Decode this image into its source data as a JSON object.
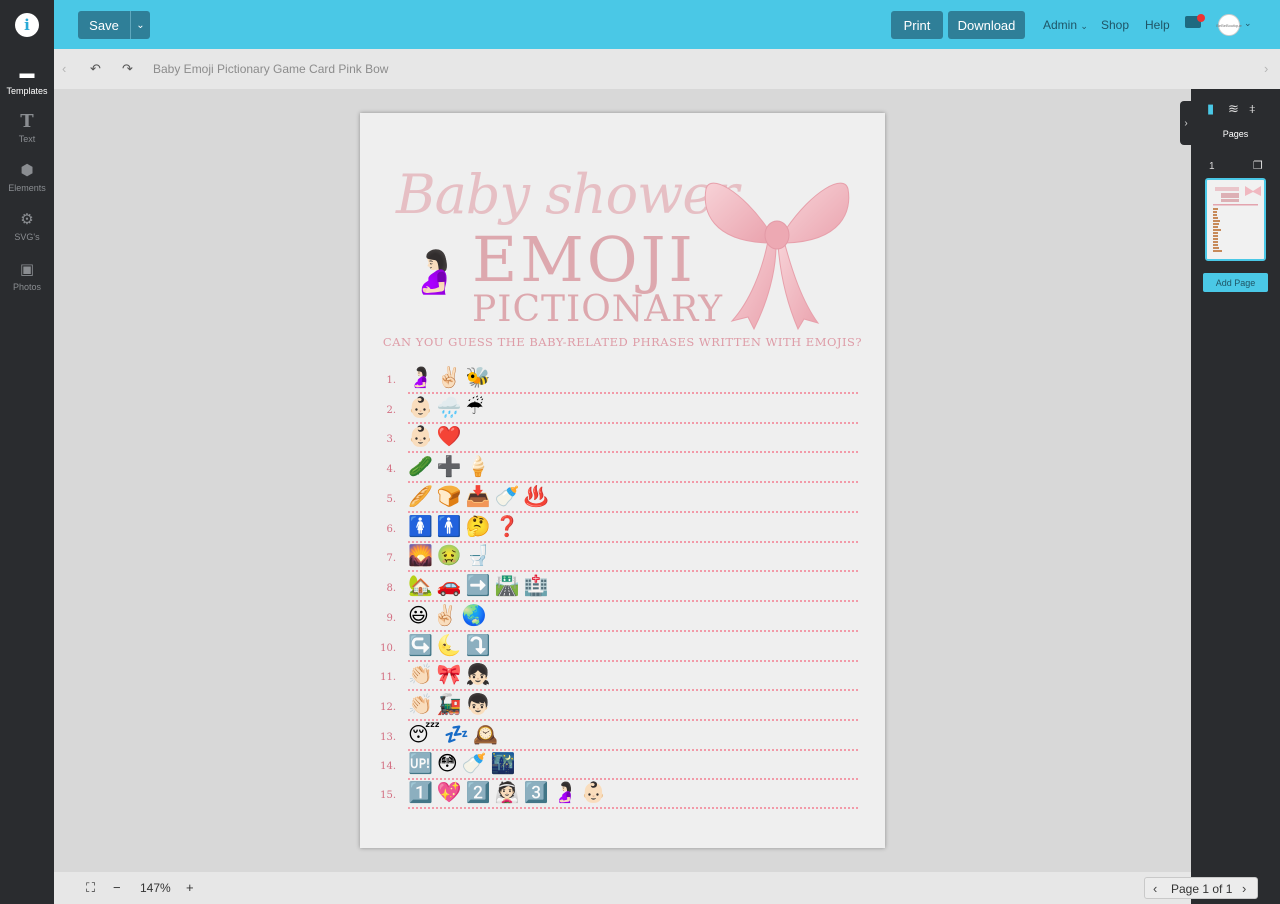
{
  "header": {
    "save_label": "Save",
    "save_dropdown_icon": "chevron-down-icon",
    "print_label": "Print",
    "download_label": "Download",
    "nav": [
      {
        "label": "Admin",
        "has_dropdown": true
      },
      {
        "label": "Shop",
        "has_dropdown": false
      },
      {
        "label": "Help",
        "has_dropdown": false
      }
    ],
    "mail_badge": "1",
    "avatar_text": "BeBeBoutique"
  },
  "sidebar": {
    "items": [
      {
        "label": "Templates",
        "icon": "folder-icon",
        "active": true
      },
      {
        "label": "Text",
        "icon": "text-icon",
        "active": false
      },
      {
        "label": "Elements",
        "icon": "cube-icon",
        "active": false
      },
      {
        "label": "SVG's",
        "icon": "gear-icon",
        "active": false
      },
      {
        "label": "Photos",
        "icon": "image-icon",
        "active": false
      }
    ]
  },
  "toolbar": {
    "doc_title": "Baby Emoji Pictionary Game Card Pink Bow"
  },
  "card": {
    "script_title": "Baby shower",
    "title_line1": "EMOJI",
    "title_line2": "PICTIONARY",
    "subtitle": "CAN YOU GUESS THE BABY-RELATED PHRASES WRITTEN WITH EMOJIS?",
    "mom_emoji": "🤰🏻",
    "colors": {
      "script": "#e6bfc4",
      "title": "#dda8ae",
      "subtitle": "#de9ca7",
      "numbers": "#d36f82",
      "dots": "#f29aa8",
      "bow": "#f0b8c0"
    },
    "rows": [
      {
        "num": "1.",
        "emojis": "🤰🏻✌🏻🐝"
      },
      {
        "num": "2.",
        "emojis": "👶🏻🌧️☔"
      },
      {
        "num": "3.",
        "emojis": "👶🏻❤️"
      },
      {
        "num": "4.",
        "emojis": "🥒➕🍦"
      },
      {
        "num": "5.",
        "emojis": "🥖🍞📥🍼♨️"
      },
      {
        "num": "6.",
        "emojis": "🚺🚹🤔❓"
      },
      {
        "num": "7.",
        "emojis": "🌄🤢🚽"
      },
      {
        "num": "8.",
        "emojis": "🏡🚗➡️🛣️🏥"
      },
      {
        "num": "9.",
        "emojis": "😃✌🏻🌏"
      },
      {
        "num": "10.",
        "emojis": "↪️🌜⤵️"
      },
      {
        "num": "11.",
        "emojis": "👏🏻🎀👧🏻"
      },
      {
        "num": "12.",
        "emojis": "👏🏻🚂👦🏻"
      },
      {
        "num": "13.",
        "emojis": "😴💤🕰️"
      },
      {
        "num": "14.",
        "emojis": "🆙😳🍼🌃"
      },
      {
        "num": "15.",
        "emojis": "1️⃣💖2️⃣👰🏻3️⃣🤰🏻👶🏻"
      }
    ]
  },
  "right_panel": {
    "pages_label": "Pages",
    "page_number": "1",
    "add_page_label": "Add Page"
  },
  "bottom": {
    "zoom": "147%",
    "pager": "Page 1 of 1"
  }
}
